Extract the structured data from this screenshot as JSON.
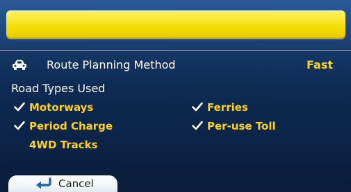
{
  "title_bar": {
    "text": ""
  },
  "route_planning": {
    "icon": "car-icon",
    "label": "Route Planning Method",
    "value": "Fast"
  },
  "road_types": {
    "title": "Road Types Used",
    "items": [
      {
        "label": "Motorways",
        "checked": true
      },
      {
        "label": "Ferries",
        "checked": true
      },
      {
        "label": "Period Charge",
        "checked": true
      },
      {
        "label": "Per-use Toll",
        "checked": true
      },
      {
        "label": "4WD Tracks",
        "checked": false
      }
    ]
  },
  "footer": {
    "cancel_label": "Cancel",
    "cancel_icon": "back-arrow-icon"
  },
  "colors": {
    "accent_yellow": "#ffd21a",
    "title_bar_yellow": "#f4dd00",
    "background_top": "#1e4a7f",
    "background_bottom": "#0a1d3a",
    "text_white": "#ffffff"
  }
}
